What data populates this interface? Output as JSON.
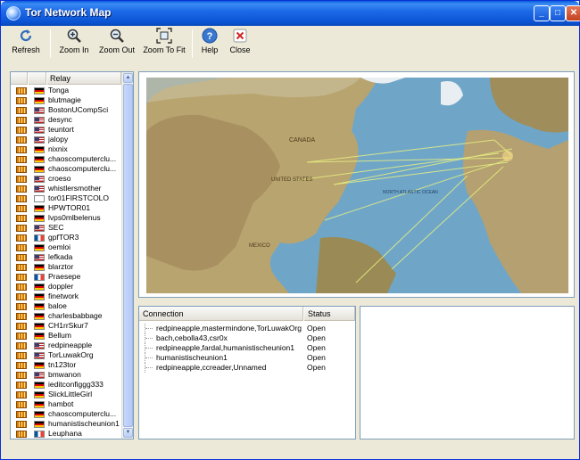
{
  "window": {
    "title": "Tor Network Map",
    "minimize": "_",
    "maximize": "□",
    "close": "✕"
  },
  "toolbar": {
    "refresh": "Refresh",
    "zoom_in": "Zoom In",
    "zoom_out": "Zoom Out",
    "zoom_to_fit": "Zoom To Fit",
    "help": "Help",
    "close": "Close"
  },
  "relay_panel": {
    "column_header": "Relay",
    "relays": [
      {
        "flag": "de",
        "name": "Tonga"
      },
      {
        "flag": "de",
        "name": "blutmagie"
      },
      {
        "flag": "us",
        "name": "BostonUCompSci"
      },
      {
        "flag": "us",
        "name": "desync"
      },
      {
        "flag": "us",
        "name": "teuntort"
      },
      {
        "flag": "us",
        "name": "jalopy"
      },
      {
        "flag": "de",
        "name": "nixnix"
      },
      {
        "flag": "de",
        "name": "chaoscomputerclu..."
      },
      {
        "flag": "de",
        "name": "chaoscomputerclu..."
      },
      {
        "flag": "us",
        "name": "croeso"
      },
      {
        "flag": "us",
        "name": "whistlersmother"
      },
      {
        "flag": "unk",
        "name": "tor01FIRSTCOLO"
      },
      {
        "flag": "de",
        "name": "HPWTOR01"
      },
      {
        "flag": "de",
        "name": "lvps0mlbelenus"
      },
      {
        "flag": "us",
        "name": "SEC"
      },
      {
        "flag": "fr",
        "name": "gpfTOR3"
      },
      {
        "flag": "de",
        "name": "oemloi"
      },
      {
        "flag": "us",
        "name": "lefkada"
      },
      {
        "flag": "de",
        "name": "blarztor"
      },
      {
        "flag": "fr",
        "name": "Praesepe"
      },
      {
        "flag": "de",
        "name": "doppler"
      },
      {
        "flag": "de",
        "name": "finetwork"
      },
      {
        "flag": "de",
        "name": "baloe"
      },
      {
        "flag": "de",
        "name": "charlesbabbage"
      },
      {
        "flag": "de",
        "name": "CH1rrSkur7"
      },
      {
        "flag": "de",
        "name": "Bellum"
      },
      {
        "flag": "us",
        "name": "redpineapple"
      },
      {
        "flag": "us",
        "name": "TorLuwakOrg"
      },
      {
        "flag": "de",
        "name": "tn123tor"
      },
      {
        "flag": "us",
        "name": "bmwanon"
      },
      {
        "flag": "de",
        "name": "ieditconfiggg333"
      },
      {
        "flag": "de",
        "name": "SlickLittleGirl"
      },
      {
        "flag": "de",
        "name": "hambot"
      },
      {
        "flag": "de",
        "name": "chaoscomputerclu..."
      },
      {
        "flag": "de",
        "name": "humanistischeunion1"
      },
      {
        "flag": "fr",
        "name": "Leuphana"
      }
    ]
  },
  "map": {
    "labels": {
      "canada": "CANADA",
      "united_states": "UNITED STATES",
      "north_atlantic": "NORTH ATLANTIC OCEAN",
      "mexico": "MEXICO"
    }
  },
  "connections_panel": {
    "col_connection": "Connection",
    "col_status": "Status",
    "rows": [
      {
        "circuit": "redpineapple,mastermindone,TorLuwakOrg",
        "status": "Open"
      },
      {
        "circuit": "bach,cebolla43,csr0x",
        "status": "Open"
      },
      {
        "circuit": "redpineapple,fardal,humanistischeunion1",
        "status": "Open"
      },
      {
        "circuit": "humanistischeunion1",
        "status": "Open"
      },
      {
        "circuit": "redpineapple,ccreader,Unnamed",
        "status": "Open"
      }
    ]
  },
  "colors": {
    "titlebar": "#0A54D3",
    "ocean": "#6fa6c8",
    "land": "#b7a26e",
    "connection_line": "#e8f080"
  }
}
